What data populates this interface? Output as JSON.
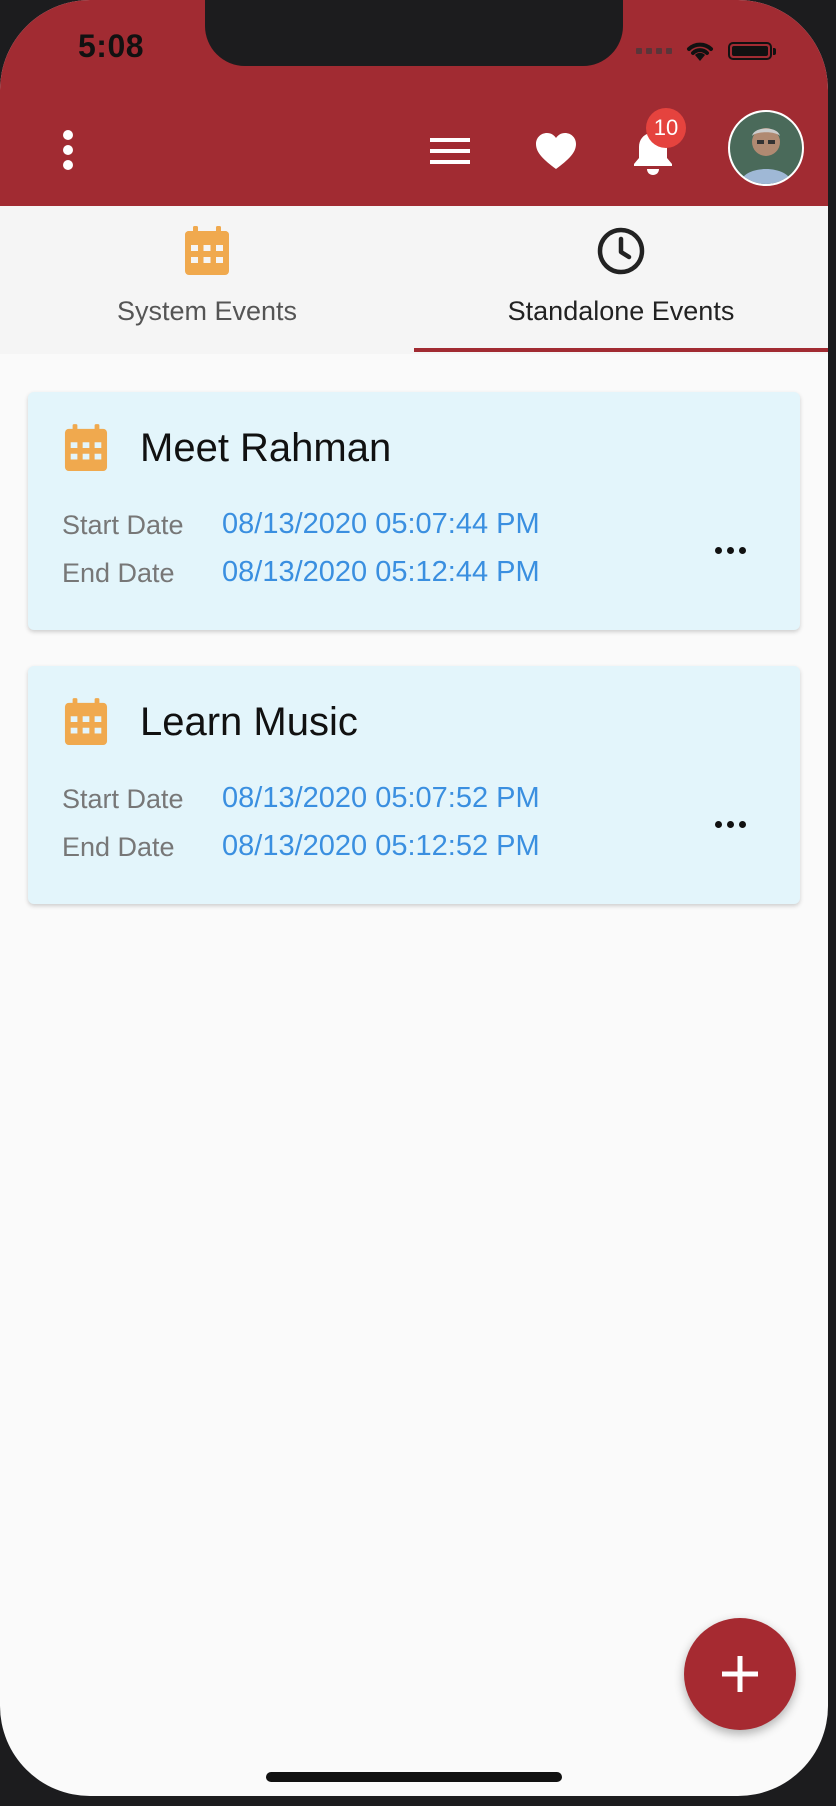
{
  "status_bar": {
    "time": "5:08"
  },
  "app_bar": {
    "more_icon": "more-vertical-icon",
    "menu_icon": "hamburger-menu-icon",
    "favorites_icon": "heart-icon",
    "notifications_icon": "bell-icon",
    "notification_count": "10",
    "avatar_icon": "user-avatar",
    "bar_color": "#a12b32"
  },
  "tabs": {
    "items": [
      {
        "label": "System Events",
        "icon": "calendar-icon",
        "selected": false
      },
      {
        "label": "Standalone Events",
        "icon": "clock-icon",
        "selected": true
      }
    ]
  },
  "events": [
    {
      "title": "Meet Rahman",
      "start_label": "Start Date",
      "start_value": "08/13/2020 05:07:44 PM",
      "end_label": "End Date",
      "end_value": "08/13/2020 05:12:44 PM"
    },
    {
      "title": "Learn Music",
      "start_label": "Start Date",
      "start_value": "08/13/2020 05:07:52 PM",
      "end_label": "End Date",
      "end_value": "08/13/2020 05:12:52 PM"
    }
  ],
  "fab": {
    "icon": "plus-icon"
  },
  "colors": {
    "primary": "#a12b32",
    "card_background": "#e3f5fb",
    "date_value": "#3a8fe0",
    "calendar_icon": "#f0a94e",
    "badge": "#e5433e"
  }
}
